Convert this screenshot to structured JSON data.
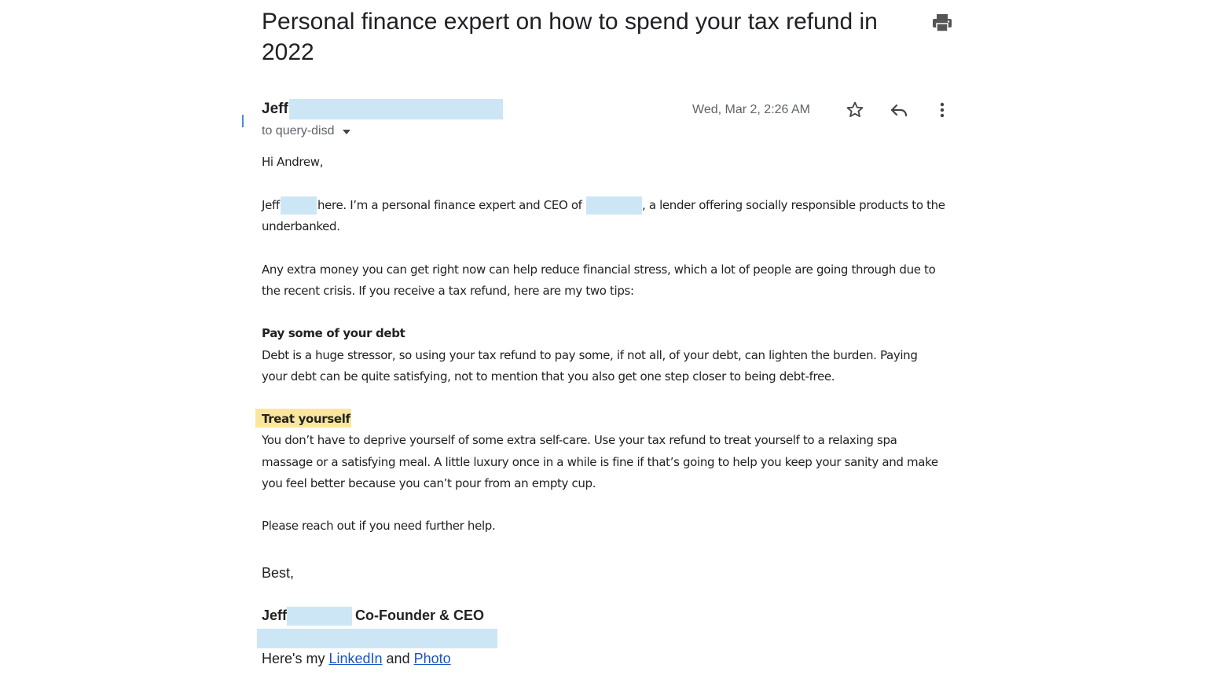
{
  "email": {
    "subject": "Personal finance expert on how to spend your tax refund in 2022",
    "sender_name": "Jeff",
    "recipient_line": "to query-disd",
    "date": "Wed, Mar 2, 2:26 AM"
  },
  "icons": {
    "print": "print-icon",
    "star": "star-icon",
    "reply": "reply-icon",
    "more": "more-vert-icon",
    "dropdown": "chevron-down-icon"
  },
  "body": {
    "greeting": "Hi Andrew,",
    "intro_a": "Jeff",
    "intro_b": "here. I’m a personal finance expert and CEO of",
    "intro_c": ", a lender offering socially responsible products to the",
    "intro_d": "underbanked.",
    "para2_line1": "Any extra money you can get right now can help reduce financial stress, which a lot of people are going through due to",
    "para2_line2": "the recent crisis. If you receive a tax refund, here are my two tips:",
    "tip1_heading": "Pay some of your debt",
    "tip1_line1": "Debt is a huge stressor, so using your tax refund to pay some, if not all, of your debt, can lighten the burden. Paying",
    "tip1_line2": "your debt can be quite satisfying, not to mention that you also get one step closer to being debt-free.",
    "tip2_heading": "Treat yourself",
    "tip2_line1": "You don’t have to deprive yourself of some extra self-care. Use your tax refund to treat yourself to a relaxing spa",
    "tip2_line2": "massage or a satisfying meal. A little luxury once in a while is fine if that’s going to help you keep your sanity and make",
    "tip2_line3": "you feel better because you can’t pour from an empty cup.",
    "closing_line": "Please reach out if you need further help."
  },
  "signature": {
    "best": "Best,",
    "name": "Jeff",
    "title": "Co-Founder & CEO",
    "links_prefix": "Here's my",
    "linkedin_label": "LinkedIn",
    "links_and": "and",
    "photo_label": "Photo"
  },
  "colors": {
    "redaction": "#cde6f5",
    "highlight": "#fbe79b",
    "link": "#1a53c4"
  }
}
